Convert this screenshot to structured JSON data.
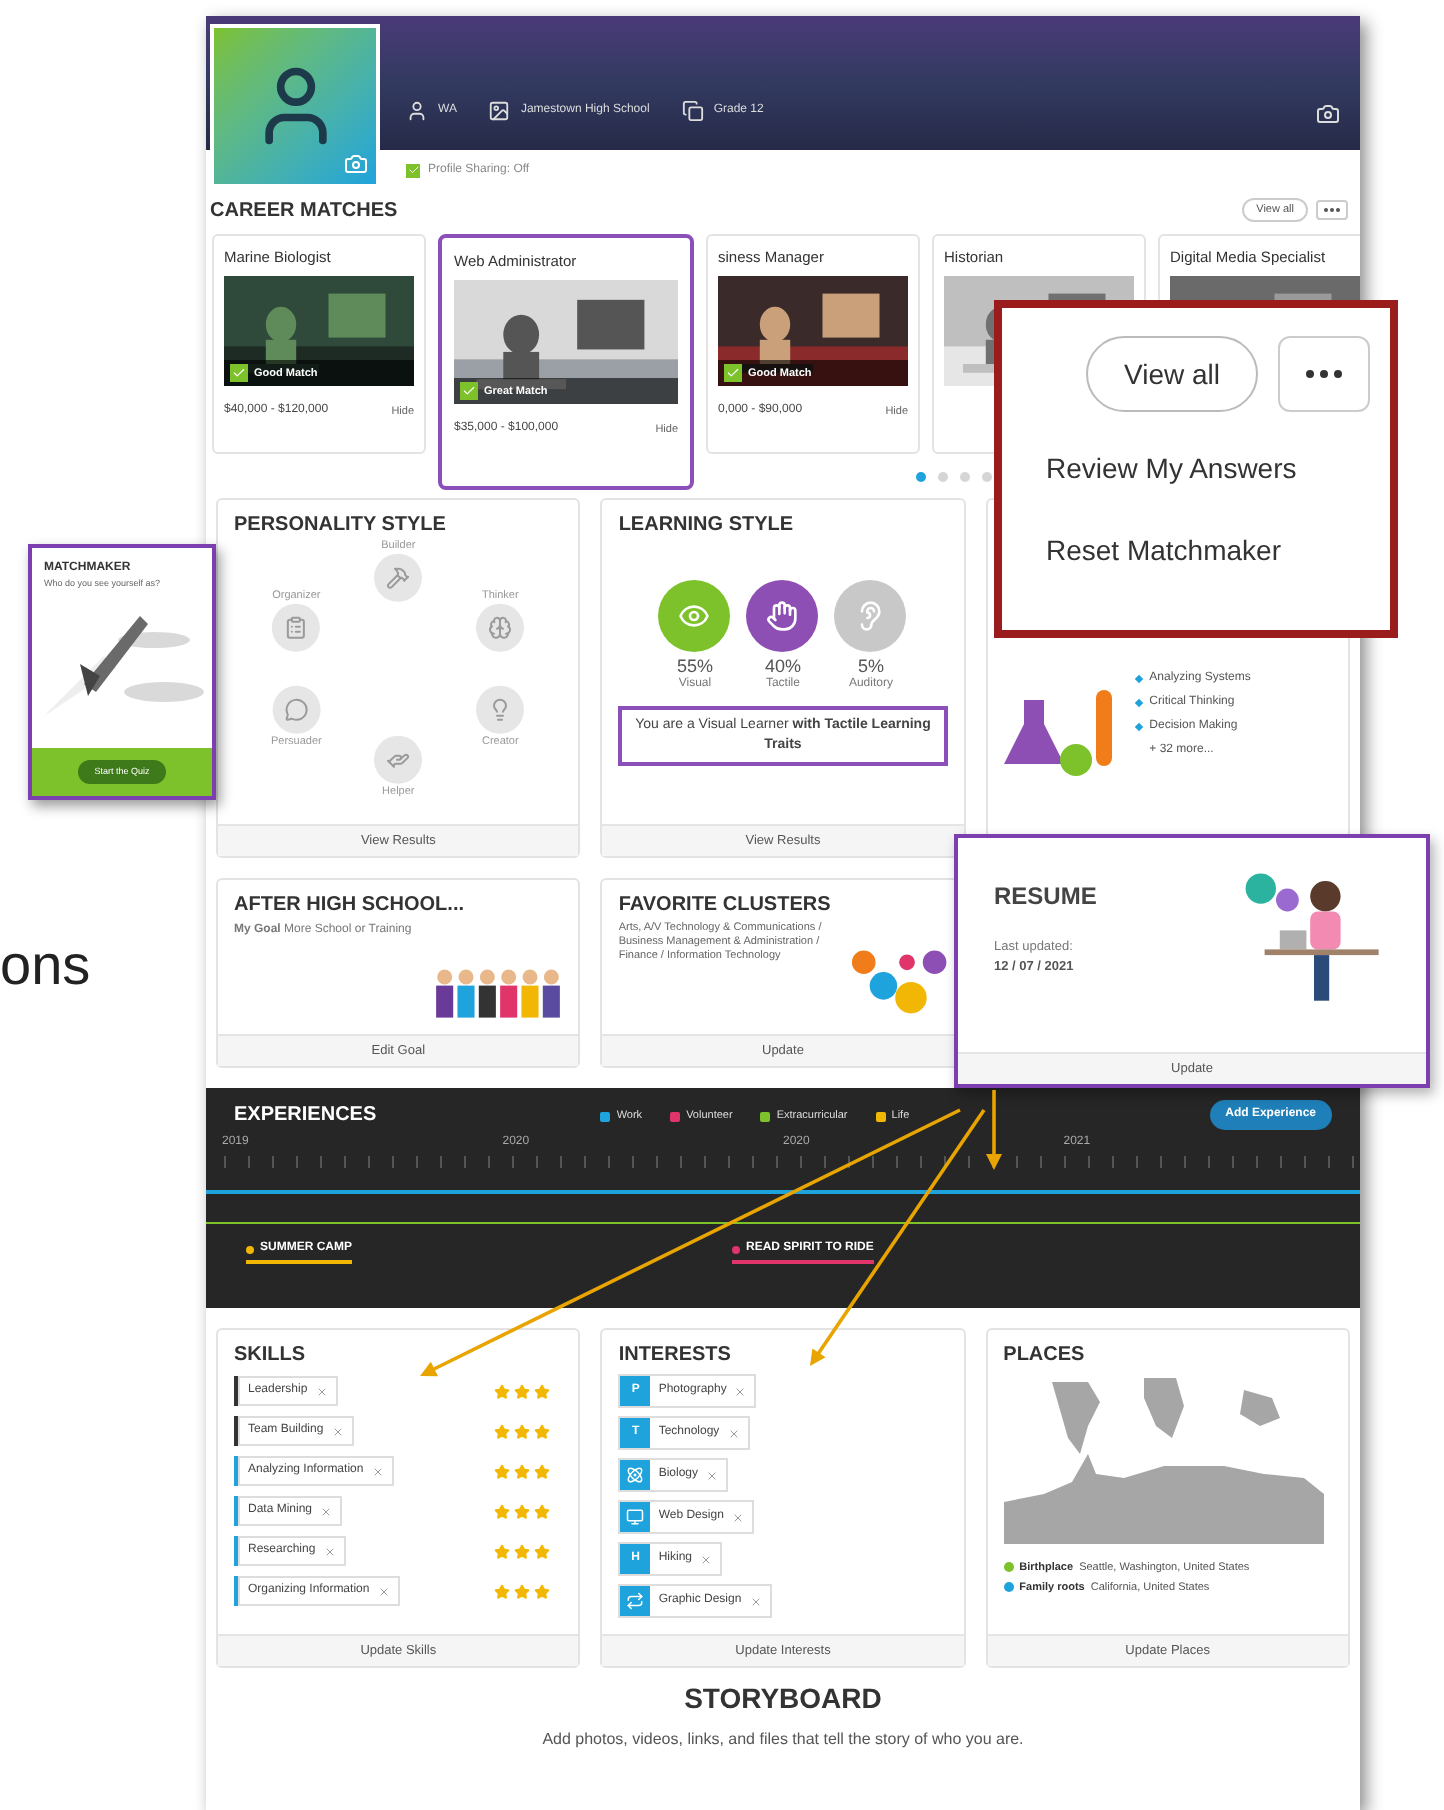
{
  "slide_text": "ons",
  "profile": {
    "items": [
      {
        "kind": "user",
        "label": "WA"
      },
      {
        "kind": "school",
        "label": "Jamestown High School"
      },
      {
        "kind": "grade",
        "label": "Grade 12"
      }
    ],
    "sharing": {
      "label": "Profile Sharing: Off",
      "checked": true
    }
  },
  "career_matches": {
    "title": "CAREER MATCHES",
    "view_all": "View all",
    "cards": [
      {
        "title": "Marine Biologist",
        "match": "Good Match",
        "salary": "$40,000 - $120,000",
        "hide": "Hide",
        "highlighted": false
      },
      {
        "title": "Web Administrator",
        "match": "Great Match",
        "salary": "$35,000 - $100,000",
        "hide": "Hide",
        "highlighted": true
      },
      {
        "title": "siness Manager",
        "match": "Good Match",
        "salary": "0,000 - $90,000",
        "hide": "Hide",
        "highlighted": false
      },
      {
        "title": "Historian",
        "highlighted": false
      },
      {
        "title": "Digital Media Specialist",
        "highlighted": false
      }
    ],
    "pages": [
      {
        "selected": true
      },
      {
        "selected": false
      },
      {
        "selected": false
      },
      {
        "selected": false
      }
    ]
  },
  "personality": {
    "title": "PERSONALITY STYLE",
    "traits": [
      "Builder",
      "Thinker",
      "Creator",
      "Helper",
      "Persuader",
      "Organizer"
    ],
    "footer": "View Results"
  },
  "learning": {
    "title": "LEARNING STYLE",
    "styles": [
      {
        "kind": "visual",
        "percent": "55%",
        "label": "Visual",
        "color": "#7dc12b"
      },
      {
        "kind": "tactile",
        "percent": "40%",
        "label": "Tactile",
        "color": "#8e4fb5"
      },
      {
        "kind": "auditory",
        "percent": "5%",
        "label": "Auditory",
        "color": "#c8c8c8"
      }
    ],
    "summary": "You are a Visual Learner **with Tactile Learning Traits**",
    "footer": "View Results"
  },
  "top_skills": {
    "items": [
      "Analyzing Systems",
      "Critical Thinking",
      "Decision Making"
    ],
    "more": "+ 32 more..."
  },
  "after_high_school": {
    "title": "AFTER HIGH SCHOOL...",
    "goal": "**My Goal** More School or Training",
    "footer": "Edit Goal"
  },
  "clusters": {
    "title": "FAVORITE CLUSTERS",
    "text": "Arts, A/V Technology & Communications / Business Management & Administration / Finance / Information Technology",
    "footer": "Update"
  },
  "experiences": {
    "title": "EXPERIENCES",
    "legend": [
      {
        "label": "Work",
        "color": "#1fa3dc"
      },
      {
        "label": "Volunteer",
        "color": "#e0356a"
      },
      {
        "label": "Extracurricular",
        "color": "#7dc12b"
      },
      {
        "label": "Life",
        "color": "#f2b705"
      }
    ],
    "add": "Add Experience",
    "years": [
      "2019",
      "2020",
      "2020",
      "2021"
    ],
    "events": [
      {
        "label": "SUMMER CAMP",
        "color": "#f2b705"
      },
      {
        "label": "READ SPIRIT TO RIDE",
        "color": "#e0356a"
      }
    ]
  },
  "skills": {
    "title": "SKILLS",
    "items": [
      {
        "label": "Leadership",
        "stars": 3,
        "color": "#333333"
      },
      {
        "label": "Team Building",
        "stars": 3,
        "color": "#333333"
      },
      {
        "label": "Analyzing Information",
        "stars": 3,
        "color": "#1fa3dc"
      },
      {
        "label": "Data Mining",
        "stars": 3,
        "color": "#1fa3dc"
      },
      {
        "label": "Researching",
        "stars": 3,
        "color": "#1fa3dc"
      },
      {
        "label": "Organizing Information",
        "stars": 3,
        "color": "#1fa3dc"
      }
    ],
    "footer": "Update Skills"
  },
  "interests": {
    "title": "INTERESTS",
    "items": [
      {
        "label": "Photography",
        "kind": "letter",
        "letter": "P"
      },
      {
        "label": "Technology",
        "kind": "letter",
        "letter": "T"
      },
      {
        "label": "Biology",
        "kind": "molecule"
      },
      {
        "label": "Web Design",
        "kind": "screen"
      },
      {
        "label": "Hiking",
        "kind": "letter",
        "letter": "H"
      },
      {
        "label": "Graphic Design",
        "kind": "arrows"
      }
    ],
    "footer": "Update Interests"
  },
  "places": {
    "title": "PLACES",
    "legend": [
      {
        "label": "Birthplace",
        "place": "Seattle, Washington, United States",
        "color": "#7dc12b"
      },
      {
        "label": "Family roots",
        "place": "California, United States",
        "color": "#1fa3dc"
      }
    ],
    "footer": "Update Places"
  },
  "storyboard": {
    "title": "STORYBOARD",
    "text": "Add photos, videos, links, and files that tell the story of who you are."
  },
  "matchmaker": {
    "title": "MATCHMAKER",
    "subtitle": "Who do you see yourself as?",
    "button": "Start the Quiz"
  },
  "menu_callout": {
    "view_all": "View all",
    "items": [
      "Review My Answers",
      "Reset Matchmaker"
    ]
  },
  "resume": {
    "title": "RESUME",
    "updated_label": "Last updated:",
    "date": "12 / 07 / 2021",
    "footer": "Update"
  }
}
